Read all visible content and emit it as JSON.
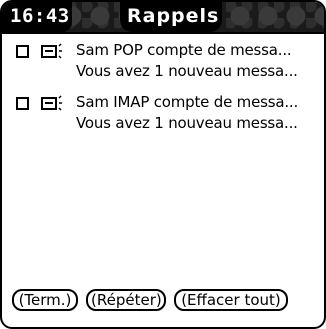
{
  "header": {
    "time": "16:43",
    "title": "Rappels"
  },
  "reminders": [
    {
      "icon": "message-notification-icon",
      "line1": "Sam POP  compte de messa...",
      "line2": "Vous avez 1 nouveau messa...",
      "checked": false
    },
    {
      "icon": "message-notification-icon",
      "line1": "Sam IMAP compte de messa...",
      "line2": "Vous avez 1 nouveau messa...",
      "checked": false
    }
  ],
  "buttons": {
    "done": "(Term.)",
    "repeat": "(Répéter)",
    "clear_all": "(Effacer tout)"
  }
}
